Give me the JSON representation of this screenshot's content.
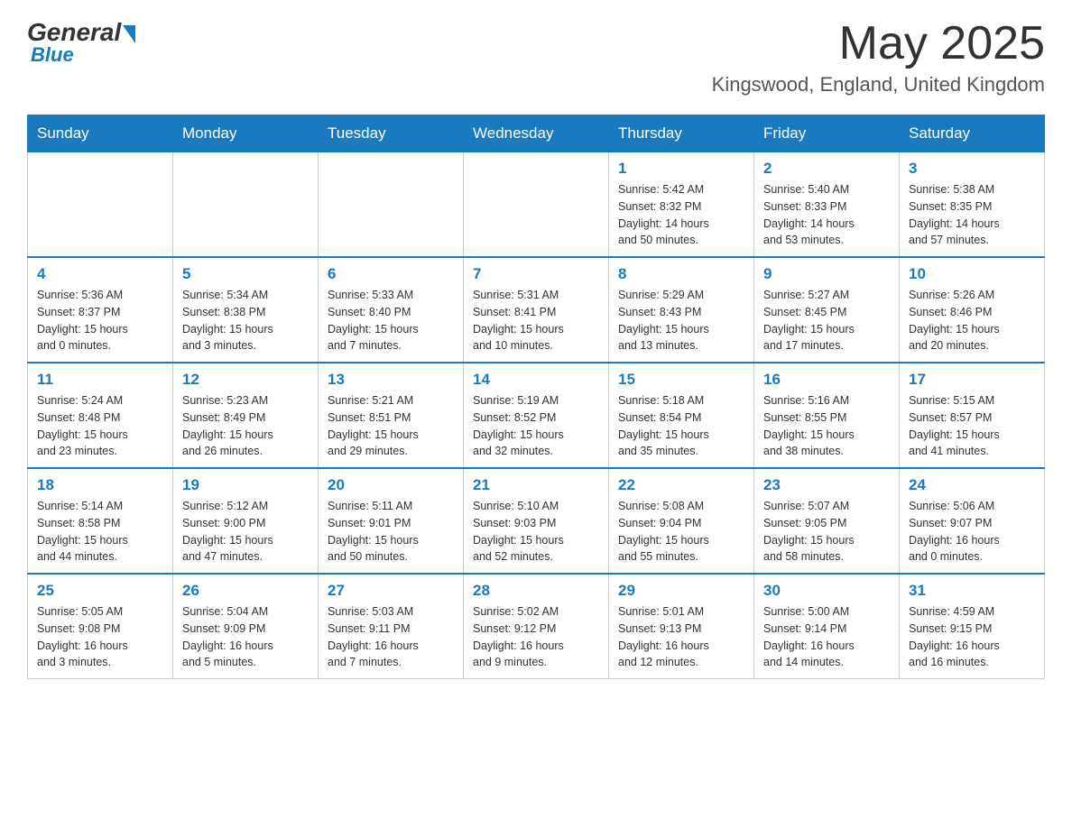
{
  "header": {
    "logo": {
      "general": "General",
      "blue": "Blue"
    },
    "title": "May 2025",
    "location": "Kingswood, England, United Kingdom"
  },
  "calendar": {
    "weekdays": [
      "Sunday",
      "Monday",
      "Tuesday",
      "Wednesday",
      "Thursday",
      "Friday",
      "Saturday"
    ],
    "weeks": [
      [
        {
          "day": "",
          "info": ""
        },
        {
          "day": "",
          "info": ""
        },
        {
          "day": "",
          "info": ""
        },
        {
          "day": "",
          "info": ""
        },
        {
          "day": "1",
          "info": "Sunrise: 5:42 AM\nSunset: 8:32 PM\nDaylight: 14 hours\nand 50 minutes."
        },
        {
          "day": "2",
          "info": "Sunrise: 5:40 AM\nSunset: 8:33 PM\nDaylight: 14 hours\nand 53 minutes."
        },
        {
          "day": "3",
          "info": "Sunrise: 5:38 AM\nSunset: 8:35 PM\nDaylight: 14 hours\nand 57 minutes."
        }
      ],
      [
        {
          "day": "4",
          "info": "Sunrise: 5:36 AM\nSunset: 8:37 PM\nDaylight: 15 hours\nand 0 minutes."
        },
        {
          "day": "5",
          "info": "Sunrise: 5:34 AM\nSunset: 8:38 PM\nDaylight: 15 hours\nand 3 minutes."
        },
        {
          "day": "6",
          "info": "Sunrise: 5:33 AM\nSunset: 8:40 PM\nDaylight: 15 hours\nand 7 minutes."
        },
        {
          "day": "7",
          "info": "Sunrise: 5:31 AM\nSunset: 8:41 PM\nDaylight: 15 hours\nand 10 minutes."
        },
        {
          "day": "8",
          "info": "Sunrise: 5:29 AM\nSunset: 8:43 PM\nDaylight: 15 hours\nand 13 minutes."
        },
        {
          "day": "9",
          "info": "Sunrise: 5:27 AM\nSunset: 8:45 PM\nDaylight: 15 hours\nand 17 minutes."
        },
        {
          "day": "10",
          "info": "Sunrise: 5:26 AM\nSunset: 8:46 PM\nDaylight: 15 hours\nand 20 minutes."
        }
      ],
      [
        {
          "day": "11",
          "info": "Sunrise: 5:24 AM\nSunset: 8:48 PM\nDaylight: 15 hours\nand 23 minutes."
        },
        {
          "day": "12",
          "info": "Sunrise: 5:23 AM\nSunset: 8:49 PM\nDaylight: 15 hours\nand 26 minutes."
        },
        {
          "day": "13",
          "info": "Sunrise: 5:21 AM\nSunset: 8:51 PM\nDaylight: 15 hours\nand 29 minutes."
        },
        {
          "day": "14",
          "info": "Sunrise: 5:19 AM\nSunset: 8:52 PM\nDaylight: 15 hours\nand 32 minutes."
        },
        {
          "day": "15",
          "info": "Sunrise: 5:18 AM\nSunset: 8:54 PM\nDaylight: 15 hours\nand 35 minutes."
        },
        {
          "day": "16",
          "info": "Sunrise: 5:16 AM\nSunset: 8:55 PM\nDaylight: 15 hours\nand 38 minutes."
        },
        {
          "day": "17",
          "info": "Sunrise: 5:15 AM\nSunset: 8:57 PM\nDaylight: 15 hours\nand 41 minutes."
        }
      ],
      [
        {
          "day": "18",
          "info": "Sunrise: 5:14 AM\nSunset: 8:58 PM\nDaylight: 15 hours\nand 44 minutes."
        },
        {
          "day": "19",
          "info": "Sunrise: 5:12 AM\nSunset: 9:00 PM\nDaylight: 15 hours\nand 47 minutes."
        },
        {
          "day": "20",
          "info": "Sunrise: 5:11 AM\nSunset: 9:01 PM\nDaylight: 15 hours\nand 50 minutes."
        },
        {
          "day": "21",
          "info": "Sunrise: 5:10 AM\nSunset: 9:03 PM\nDaylight: 15 hours\nand 52 minutes."
        },
        {
          "day": "22",
          "info": "Sunrise: 5:08 AM\nSunset: 9:04 PM\nDaylight: 15 hours\nand 55 minutes."
        },
        {
          "day": "23",
          "info": "Sunrise: 5:07 AM\nSunset: 9:05 PM\nDaylight: 15 hours\nand 58 minutes."
        },
        {
          "day": "24",
          "info": "Sunrise: 5:06 AM\nSunset: 9:07 PM\nDaylight: 16 hours\nand 0 minutes."
        }
      ],
      [
        {
          "day": "25",
          "info": "Sunrise: 5:05 AM\nSunset: 9:08 PM\nDaylight: 16 hours\nand 3 minutes."
        },
        {
          "day": "26",
          "info": "Sunrise: 5:04 AM\nSunset: 9:09 PM\nDaylight: 16 hours\nand 5 minutes."
        },
        {
          "day": "27",
          "info": "Sunrise: 5:03 AM\nSunset: 9:11 PM\nDaylight: 16 hours\nand 7 minutes."
        },
        {
          "day": "28",
          "info": "Sunrise: 5:02 AM\nSunset: 9:12 PM\nDaylight: 16 hours\nand 9 minutes."
        },
        {
          "day": "29",
          "info": "Sunrise: 5:01 AM\nSunset: 9:13 PM\nDaylight: 16 hours\nand 12 minutes."
        },
        {
          "day": "30",
          "info": "Sunrise: 5:00 AM\nSunset: 9:14 PM\nDaylight: 16 hours\nand 14 minutes."
        },
        {
          "day": "31",
          "info": "Sunrise: 4:59 AM\nSunset: 9:15 PM\nDaylight: 16 hours\nand 16 minutes."
        }
      ]
    ]
  }
}
